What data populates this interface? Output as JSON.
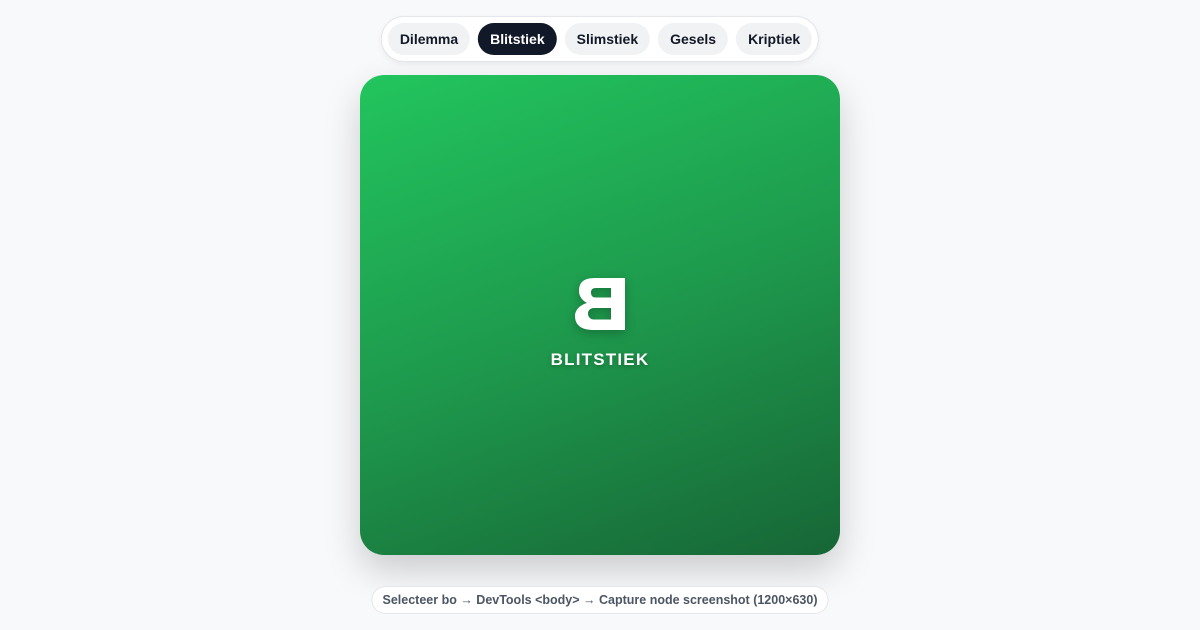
{
  "tabs": [
    {
      "label": "Dilemma",
      "active": false
    },
    {
      "label": "Blitstiek",
      "active": true
    },
    {
      "label": "Slimstiek",
      "active": false
    },
    {
      "label": "Gesels",
      "active": false
    },
    {
      "label": "Kriptiek",
      "active": false
    }
  ],
  "card": {
    "logo_icon": "mirrored-b-logo",
    "title": "BLITSTIEK",
    "gradient_start": "#22c55e",
    "gradient_end": "#176636"
  },
  "hint": {
    "text": "Selecteer bo → DevTools <body> → Capture node screenshot (1200×630)"
  },
  "colors": {
    "active_tab_bg": "#111827",
    "inactive_tab_bg": "#f1f2f4",
    "page_bg": "#f8f9fb"
  }
}
